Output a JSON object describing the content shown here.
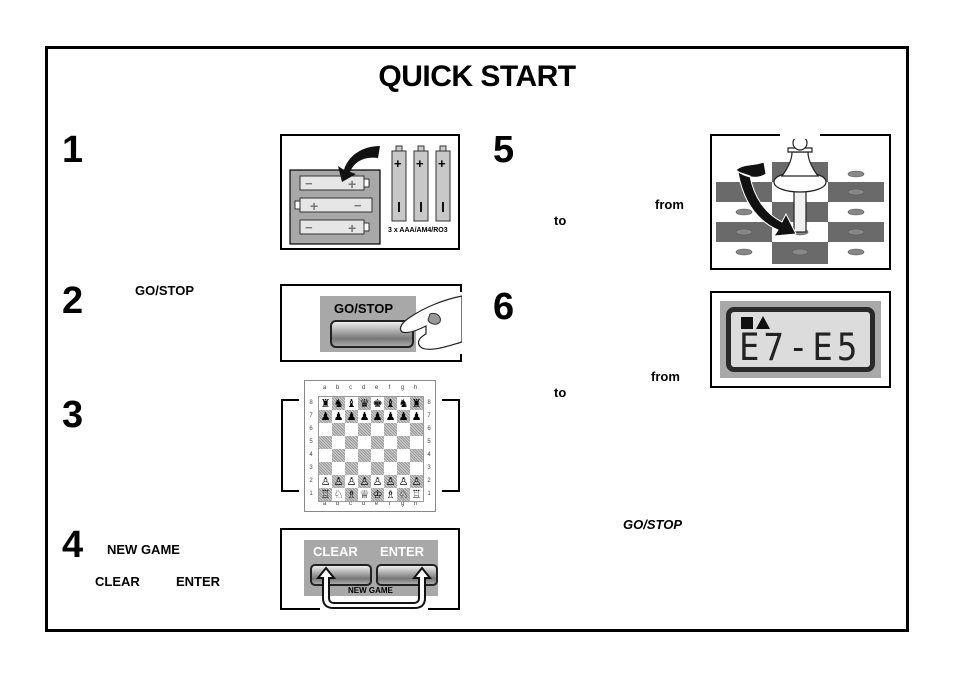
{
  "title": "QUICK START",
  "steps": [
    {
      "number": "1",
      "battery_label": "3 x AAA/AM4/RO3"
    },
    {
      "number": "2",
      "key_label": "GO/STOP",
      "button_label": "GO/STOP"
    },
    {
      "number": "3",
      "files": [
        "a",
        "b",
        "c",
        "d",
        "e",
        "f",
        "g",
        "h"
      ],
      "ranks": [
        "8",
        "7",
        "6",
        "5",
        "4",
        "3",
        "2",
        "1"
      ]
    },
    {
      "number": "4",
      "key_new_game": "NEW GAME",
      "key_clear": "CLEAR",
      "key_enter": "ENTER",
      "panel_clear": "CLEAR",
      "panel_enter": "ENTER",
      "panel_new_game": "NEW GAME"
    },
    {
      "number": "5",
      "from_label": "from",
      "to_label": "to"
    },
    {
      "number": "6",
      "from_label": "from",
      "to_label": "to",
      "lcd_text": "E7-E5",
      "gostop_label": "GO/STOP"
    }
  ]
}
